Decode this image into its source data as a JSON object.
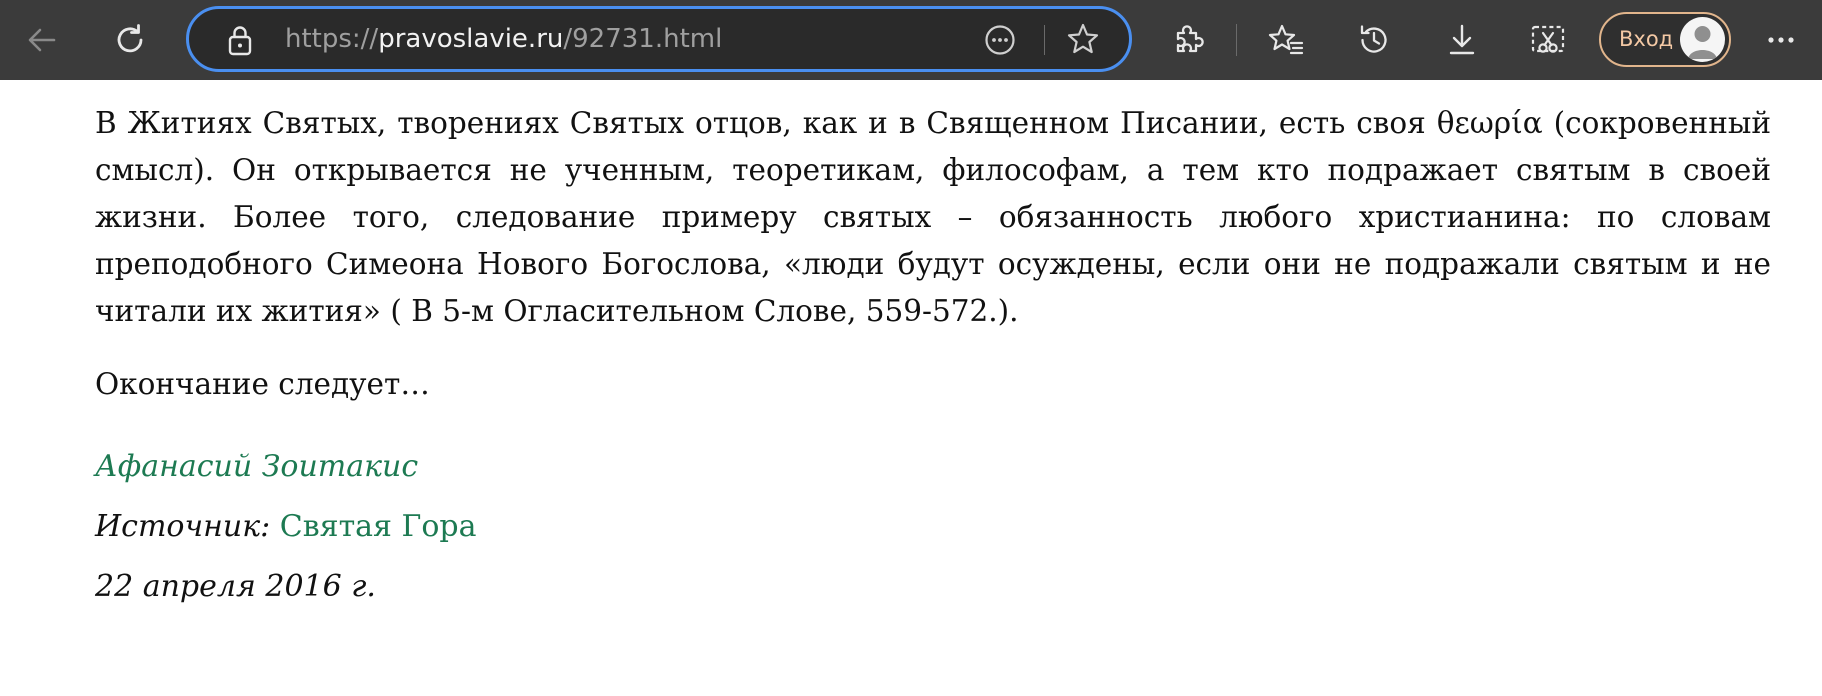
{
  "browser": {
    "url_scheme": "https://",
    "url_host": "pravoslavie.ru",
    "url_path": "/92731.html",
    "signin_label": "Вход",
    "icons": {
      "back": "arrow-left-icon",
      "reload": "reload-icon",
      "lock": "lock-icon",
      "more": "more-circle-icon",
      "favorite": "star-icon",
      "extensions": "puzzle-icon",
      "favorites": "favorites-list-icon",
      "history": "history-icon",
      "downloads": "download-icon",
      "screenshot": "screenshot-scissors-icon",
      "profile": "avatar-icon",
      "menu": "ellipsis-icon"
    },
    "colors": {
      "toolbar": "#3b3b3b",
      "address_focus": "#4a8ff0",
      "signin_border": "#e1b58c"
    }
  },
  "article": {
    "paragraph1": "В Житиях Святых, творениях Святых отцов, как и в Священном Писании, есть своя θεωρία (сокровенный смысл). Он открывается не ученным, теоретикам, философам, а тем кто подражает святым в своей жизни. Более того, следование примеру святых – обязанность любого христианина: по словам преподобного Симеона Нового Богослова, «люди будут осуждены, если они не подражали святым и не читали их жития» ( В 5-м Огласительном Слове, 559-572.).",
    "paragraph2": "Окончание следует…",
    "author": "Афанасий Зоитакис",
    "source_label": "Источник:",
    "source_name": "Святая Гора",
    "date": "22 апреля 2016 г.",
    "link_color": "#1d7a52"
  }
}
